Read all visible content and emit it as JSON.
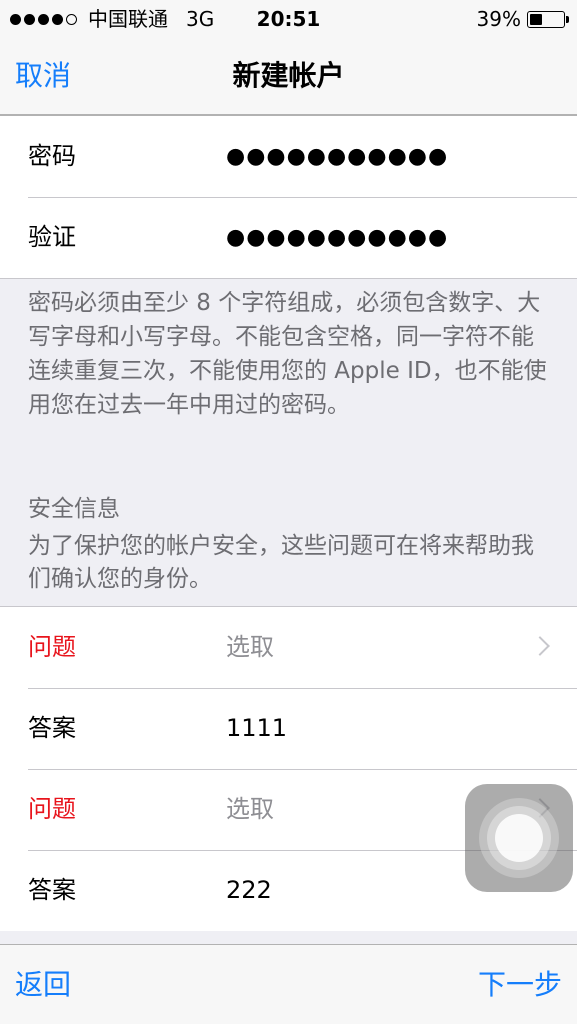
{
  "status_bar": {
    "carrier": "中国联通",
    "network": "3G",
    "time": "20:51",
    "battery_text": "39%",
    "battery_level": 0.39
  },
  "nav": {
    "cancel": "取消",
    "title": "新建帐户"
  },
  "password_fields": [
    {
      "label": "密码",
      "value": "●●●●●●●●●●●"
    },
    {
      "label": "验证",
      "value": "●●●●●●●●●●●"
    }
  ],
  "password_note": "密码必须由至少 8 个字符组成，必须包含数字、大写字母和小写字母。不能包含空格，同一字符不能连续重复三次，不能使用您的 Apple ID，也不能使用您在过去一年中用过的密码。",
  "security": {
    "header": "安全信息",
    "description": "为了保护您的帐户安全，这些问题可在将来帮助我们确认您的身份。",
    "items": [
      {
        "label": "问题",
        "value": "选取"
      },
      {
        "label": "答案",
        "value": "1111"
      },
      {
        "label": "问题",
        "value": "选取"
      },
      {
        "label": "答案",
        "value": "222"
      }
    ]
  },
  "toolbar": {
    "back": "返回",
    "next": "下一步"
  },
  "colors": {
    "accent": "#157efb",
    "error": "#e8141c",
    "background": "#efeff4"
  }
}
